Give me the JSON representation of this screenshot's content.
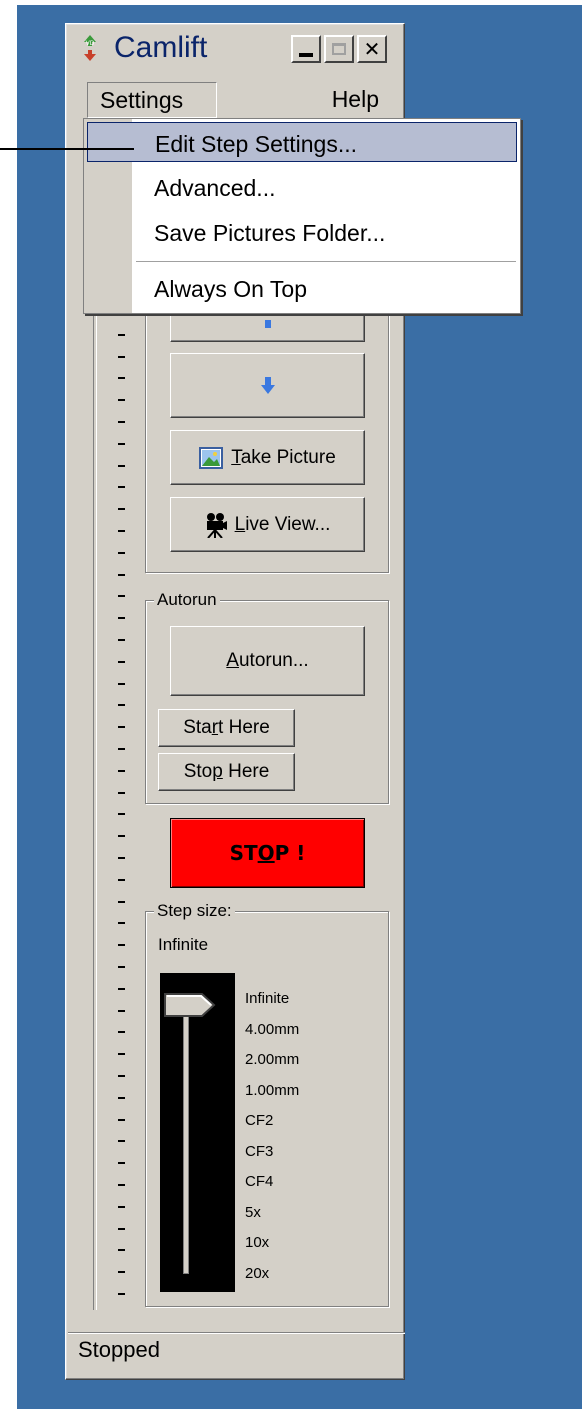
{
  "window": {
    "title": "Camlift",
    "app_icon": "camlift-logo-icon",
    "controls": [
      "minimize-icon",
      "maximize-icon",
      "close-icon"
    ]
  },
  "menubar": {
    "settings": "Settings",
    "help": "Help"
  },
  "settings_menu": {
    "items": [
      {
        "label": "Edit Step Settings...",
        "highlighted": true
      },
      {
        "label": "Advanced..."
      },
      {
        "label": "Save Pictures Folder..."
      },
      {
        "label": "Always On Top"
      }
    ]
  },
  "move": {
    "up_icon": "arrow-up-icon",
    "down_icon": "arrow-down-icon",
    "take_picture": {
      "label": "Take Picture",
      "mnemonic": "T",
      "rest": "ake Picture",
      "icon": "picture-icon"
    },
    "live_view": {
      "label": "Live View...",
      "mnemonic": "L",
      "rest": "ive View...",
      "icon": "movie-camera-icon"
    }
  },
  "autorun": {
    "group_label": "Autorun",
    "button": {
      "label": "Autorun...",
      "mnemonic": "A",
      "rest": "utorun..."
    },
    "start_here": {
      "label": "Start Here",
      "pre": "Sta",
      "mnemonic": "r",
      "post": "t Here"
    },
    "stop_here": {
      "label": "Stop Here",
      "pre": "Sto",
      "mnemonic": "p",
      "post": " Here"
    }
  },
  "stop_button": {
    "label": "STOP !",
    "pre": "ST",
    "mnemonic": "O",
    "post": "P !",
    "color": "#ff0000"
  },
  "step_size": {
    "group_label": "Step size:",
    "current": "Infinite",
    "options": [
      "Infinite",
      "4.00mm",
      "2.00mm",
      "1.00mm",
      "CF2",
      "CF3",
      "CF4",
      "5x",
      "10x",
      "20x"
    ],
    "selected_index": 0
  },
  "status": "Stopped",
  "colors": {
    "desktop": "#3a6ea5",
    "face": "#d4d0c8",
    "menu_highlight": "#b6bdd2",
    "title_text": "#0a246a"
  }
}
